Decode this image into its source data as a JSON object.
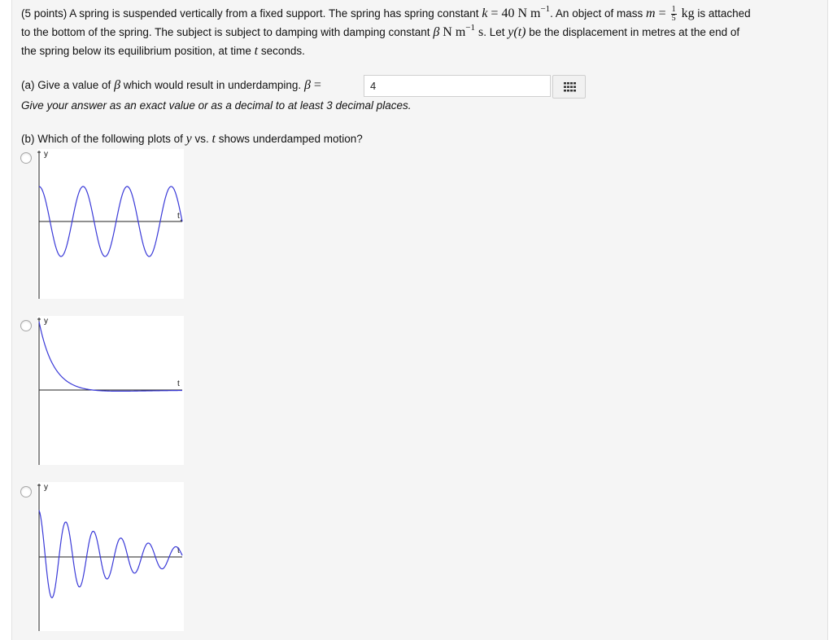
{
  "problem": {
    "points": "(5 points) A spring is suspended vertically from a fixed support. The spring has spring constant",
    "k_sym": "k",
    "k_eq": " = 40 N m",
    "k_exp": "−1",
    "mass_text": ". An object of mass",
    "m_sym": "m",
    "m_eq": " = ",
    "m_num": "1",
    "m_den": "5",
    "m_unit": " kg",
    "line1_end": " is attached",
    "line2_start": "to the bottom of the spring. The subject is subject to damping with damping constant",
    "beta_sym": "β",
    "beta_unit": " N m",
    "beta_exp": "−1",
    "s_unit": " s",
    "line2_mid": ". Let",
    "y_of_t": "y(t)",
    "line2_end": " be the displacement in metres at the end of",
    "line3_start": "the spring below its equilibrium position, at time",
    "t_sym": "t",
    "line3_end": " seconds."
  },
  "part_a": {
    "label": "(a)",
    "text": " Give a value of",
    "beta_sym": "β",
    "text2": " which would result in underdamping.",
    "eq": " = ",
    "answer": "4",
    "hint": "Give your answer as an exact value or as a decimal to at least 3 decimal places."
  },
  "part_b": {
    "label": "(b)",
    "text": " Which of the following plots of",
    "y_sym": "y",
    "vs": " vs.",
    "t_sym": "t",
    "text2": " shows underdamped motion?"
  },
  "plots": [
    {
      "type": "undamped oscillation",
      "y_label": "y",
      "t_label": "t",
      "curve_color": "#3a3ad8"
    },
    {
      "type": "overdamped decay",
      "y_label": "y",
      "t_label": "t",
      "curve_color": "#3a3ad8"
    },
    {
      "type": "underdamped oscillation",
      "y_label": "y",
      "t_label": "t",
      "curve_color": "#3a3ad8"
    }
  ],
  "icons": {
    "answer_tools": "grid-icon"
  }
}
